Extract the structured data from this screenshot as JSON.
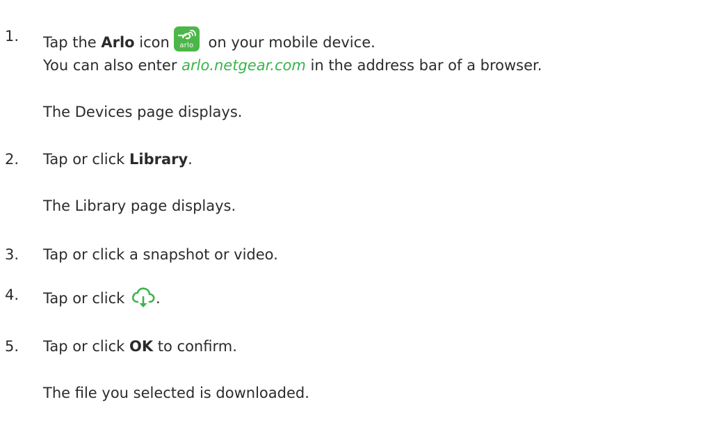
{
  "steps": [
    {
      "number": "1.",
      "before": "Tap the ",
      "bold": "Arlo",
      "after_bold": " icon",
      "after_icon": " on your mobile device.",
      "icon": "arlo-app-icon",
      "icon_label": "arlo",
      "notes": [
        {
          "before": "You can also enter ",
          "link": "arlo.netgear.com",
          "after": " in the address bar of a browser."
        },
        {
          "text": "The Devices page displays."
        }
      ]
    },
    {
      "number": "2.",
      "before": "Tap or click ",
      "bold": "Library",
      "after": ".",
      "notes": [
        {
          "text": "The Library page displays."
        }
      ]
    },
    {
      "number": "3.",
      "text": "Tap or click a snapshot or video."
    },
    {
      "number": "4.",
      "before": "Tap or click ",
      "icon": "cloud-download-icon",
      "after": "."
    },
    {
      "number": "5.",
      "before": "Tap or click ",
      "bold": "OK",
      "after": " to confirm.",
      "notes": [
        {
          "text": "The file you selected is downloaded."
        }
      ]
    }
  ],
  "colors": {
    "text": "#2b2b2b",
    "accent": "#39b54a",
    "icon_bg": "#4cb748"
  }
}
